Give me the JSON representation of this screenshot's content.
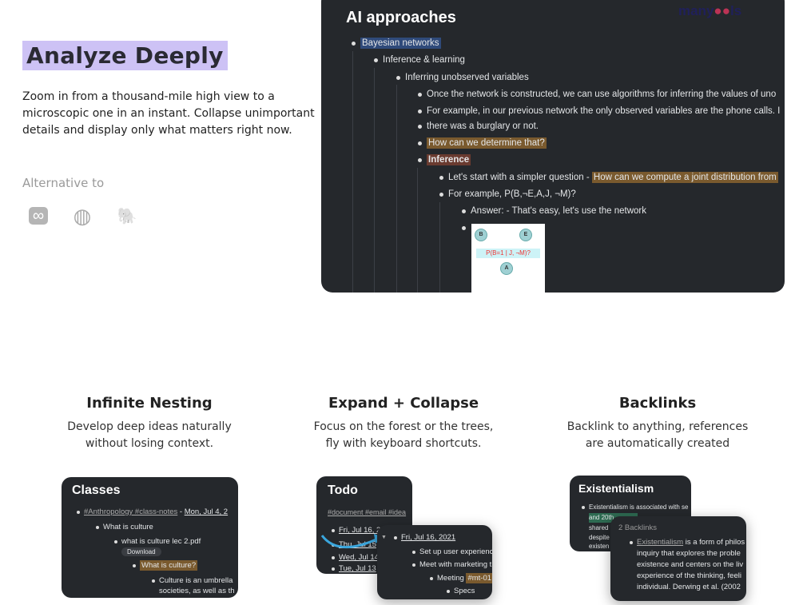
{
  "hero": {
    "title": "Analyze Deeply",
    "description": "Zoom in from a thousand-mile high view to a microscopic one in an instant. Collapse unimportant details and display only what matters right now.",
    "alternative_label": "Alternative to",
    "alternatives": [
      {
        "icon": "infinity-icon",
        "glyph": "∞"
      },
      {
        "icon": "basketball-icon",
        "glyph": "◍"
      },
      {
        "icon": "evernote-elephant-icon",
        "glyph": "🐘"
      }
    ]
  },
  "main_card": {
    "title": "AI approaches",
    "logo": "manytools",
    "rows": [
      "Bayesian networks",
      "Inference & learning",
      "Inferring unobserved variables",
      "Once the network is constructed, we can use algorithms for inferring the values of uno",
      "For example, in our previous network the only observed variables are the phone calls. I",
      "there was a burglary or not.",
      "How can we determine that?",
      "Inference",
      "Let's start with a simpler question - ",
      "How can we compute a joint distribution from",
      "For example, P(B,¬E,A,J, ¬M)?",
      "Answer: - That's easy, let's use the network"
    ],
    "diagram": {
      "nodes": [
        "B",
        "E",
        "A"
      ],
      "query": "P(B=1 | J, ¬M)?"
    }
  },
  "features": [
    {
      "title": "Infinite Nesting",
      "description": "Develop deep ideas naturally without losing context."
    },
    {
      "title": "Expand + Collapse",
      "description": "Focus on the forest or the trees, fly with keyboard shortcuts."
    },
    {
      "title": "Backlinks",
      "description": "Backlink to anything, references are automatically created"
    }
  ],
  "classes": {
    "title": "Classes",
    "tags": "#Anthropology #class-notes",
    "date": "Mon, Jul 4, 2",
    "rows": [
      "What is culture",
      "what is culture lec 2.pdf",
      "Download",
      "What is culture?",
      "Culture is an umbrella",
      "societies, as well as th"
    ]
  },
  "todo": {
    "title": "Todo",
    "tags": "#document #email #idea",
    "dates": [
      "Fri, Jul 16, 2",
      "Thu, Jul 15",
      "Wed, Jul 14",
      "Tue, Jul 13"
    ],
    "expanded_date": "Fri, Jul 16, 2021",
    "rows": [
      "Set up user experienc",
      "Meet with marketing t",
      "Meeting ",
      "#mt-01",
      "Specs"
    ],
    "arrow_color": "#3aa6dd"
  },
  "backlinks": {
    "title": "Existentialism",
    "rows": [
      "Existentialism is associated with se",
      "and 20th",
      "shared",
      "despite",
      "existen"
    ],
    "count_label": "2 Backlinks",
    "link": "Existentialism",
    "link_rest": " is a form of philos",
    "lines": [
      "inquiry that explores the proble",
      "existence and centers on the liv",
      "experience of the thinking, feeli",
      "individual. Derwing et al. (2002"
    ]
  }
}
